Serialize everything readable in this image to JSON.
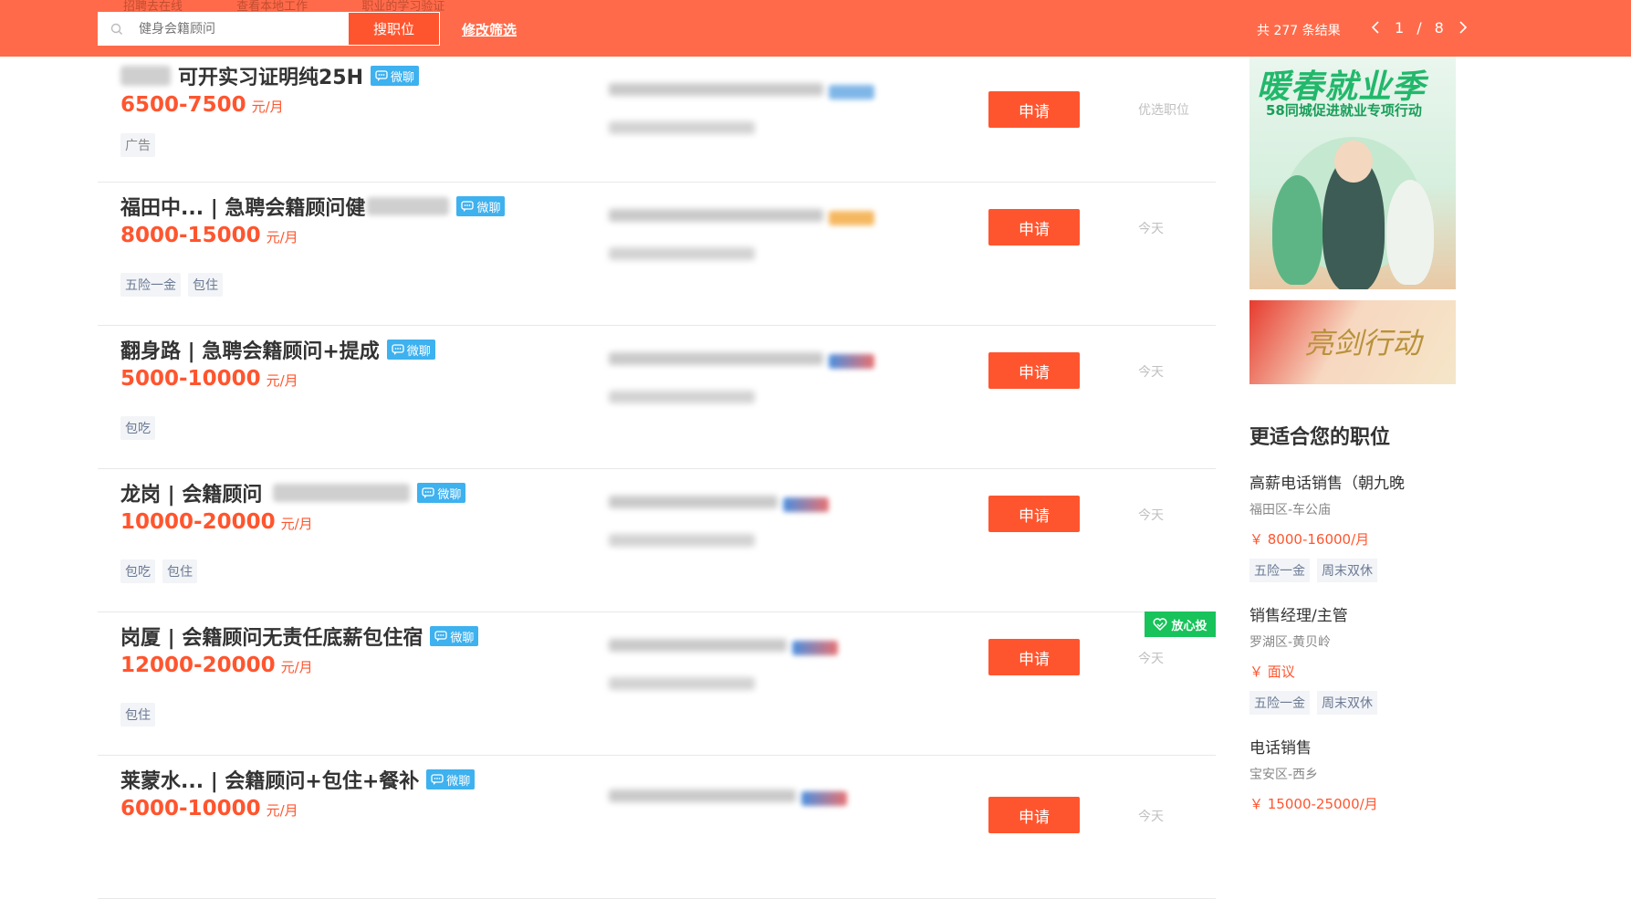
{
  "header": {
    "ghost_links": [
      "招聘去在线",
      "查看本地工作",
      "职业的学习验证"
    ],
    "search_placeholder": "健身会籍顾问",
    "search_button": "搜职位",
    "modify_filter": "修改筛选",
    "result_count": "共 277 条结果",
    "page_current": "1",
    "page_sep": "/",
    "page_total": "8"
  },
  "jobs": [
    {
      "prefix_blurred": true,
      "title": "可开实习证明纯25H",
      "wechat": "微聊",
      "salary": "6500-7500",
      "unit": "元/月",
      "tags": [
        "广告"
      ],
      "date": "优选职位",
      "apply": "申请",
      "badge_color": "#7fb6e8"
    },
    {
      "title": "福田中... | 急聘会籍顾问健",
      "suffix_blurred": true,
      "wechat": "微聊",
      "salary": "8000-15000",
      "unit": "元/月",
      "tags": [
        "五险一金",
        "包住"
      ],
      "date": "今天",
      "apply": "申请",
      "badge_color": "#f5b860"
    },
    {
      "title": "翻身路 | 急聘会籍顾问+提成",
      "wechat": "微聊",
      "salary": "5000-10000",
      "unit": "元/月",
      "tags": [
        "包吃"
      ],
      "date": "今天",
      "apply": "申请",
      "badge_color": "#e06060"
    },
    {
      "title": "龙岗 | 会籍顾问",
      "suffix_blurred": true,
      "wechat": "微聊",
      "salary": "10000-20000",
      "unit": "元/月",
      "tags": [
        "包吃",
        "包住"
      ],
      "date": "今天",
      "apply": "申请",
      "badge_color": "#e06060"
    },
    {
      "title": "岗厦 | 会籍顾问无责任底薪包住宿",
      "wechat": "微聊",
      "salary": "12000-20000",
      "unit": "元/月",
      "tags": [
        "包住"
      ],
      "date": "今天",
      "apply": "申请",
      "trust": "放心投",
      "badge_color": "#e06060"
    },
    {
      "title": "莱蒙水... | 会籍顾问+包住+餐补",
      "wechat": "微聊",
      "salary": "6000-10000",
      "unit": "元/月",
      "tags": [],
      "date": "今天",
      "apply": "申请",
      "badge_color": "#e06060"
    }
  ],
  "sidebar": {
    "banner1_title": "暖春就业季",
    "banner1_sub": "58同城促进就业专项行动",
    "banner2_text": "亮剑行动",
    "section_title": "更适合您的职位",
    "jobs": [
      {
        "title": "高薪电话销售（朝九晚",
        "loc": "福田区-车公庙",
        "salary": "￥ 8000-16000/月",
        "tags": [
          "五险一金",
          "周末双休"
        ]
      },
      {
        "title": "销售经理/主管",
        "loc": "罗湖区-黄贝岭",
        "salary": "￥ 面议",
        "tags": [
          "五险一金",
          "周末双休"
        ]
      },
      {
        "title": "电话销售",
        "loc": "宝安区-西乡",
        "salary": "￥ 15000-25000/月",
        "tags": []
      }
    ]
  }
}
